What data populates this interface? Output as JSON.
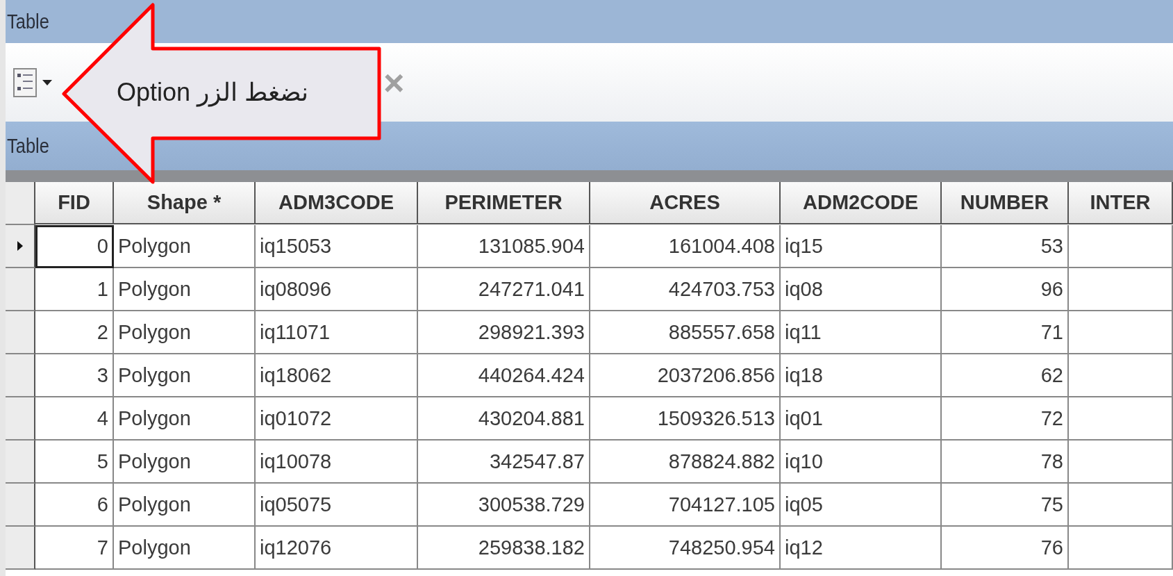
{
  "window": {
    "title": "Table"
  },
  "toolbar": {
    "close_label": "×"
  },
  "table_title": "Table",
  "callout": {
    "text": "نضغط الزر Option"
  },
  "table": {
    "columns": [
      "FID",
      "Shape *",
      "ADM3CODE",
      "PERIMETER",
      "ACRES",
      "ADM2CODE",
      "NUMBER",
      "INTER"
    ],
    "rows": [
      {
        "selected": true,
        "cells": [
          "0",
          "Polygon",
          "iq15053",
          "131085.904",
          "161004.408",
          "iq15",
          "53"
        ]
      },
      {
        "selected": false,
        "cells": [
          "1",
          "Polygon",
          "iq08096",
          "247271.041",
          "424703.753",
          "iq08",
          "96"
        ]
      },
      {
        "selected": false,
        "cells": [
          "2",
          "Polygon",
          "iq11071",
          "298921.393",
          "885557.658",
          "iq11",
          "71"
        ]
      },
      {
        "selected": false,
        "cells": [
          "3",
          "Polygon",
          "iq18062",
          "440264.424",
          "2037206.856",
          "iq18",
          "62"
        ]
      },
      {
        "selected": false,
        "cells": [
          "4",
          "Polygon",
          "iq01072",
          "430204.881",
          "1509326.513",
          "iq01",
          "72"
        ]
      },
      {
        "selected": false,
        "cells": [
          "5",
          "Polygon",
          "iq10078",
          "342547.87",
          "878824.882",
          "iq10",
          "78"
        ]
      },
      {
        "selected": false,
        "cells": [
          "6",
          "Polygon",
          "iq05075",
          "300538.729",
          "704127.105",
          "iq05",
          "75"
        ]
      },
      {
        "selected": false,
        "cells": [
          "7",
          "Polygon",
          "iq12076",
          "259838.182",
          "748250.954",
          "iq12",
          "76"
        ]
      }
    ]
  }
}
